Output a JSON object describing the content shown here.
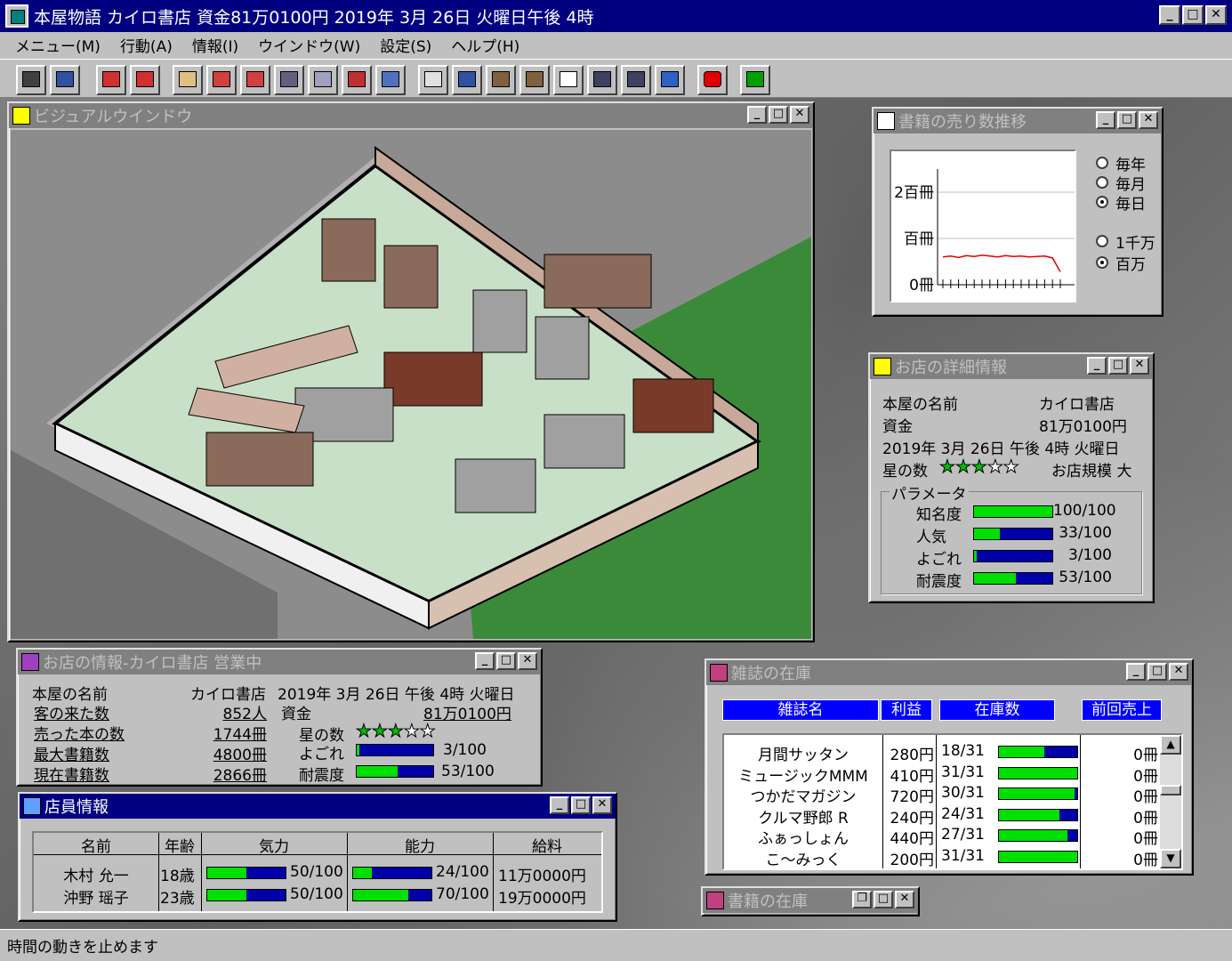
{
  "app": {
    "title": "本屋物語 カイロ書店 資金81万0100円 2019年 3月 26日 火曜日午後 4時"
  },
  "menu": [
    "メニュー(M)",
    "行動(A)",
    "情報(I)",
    "ウインドウ(W)",
    "設定(S)",
    "ヘルプ(H)"
  ],
  "visual_window": {
    "title": "ビジュアルウインドウ"
  },
  "sales_chart": {
    "title": "書籍の売り数推移",
    "radio_period": [
      "毎年",
      "毎月",
      "毎日"
    ],
    "selected_period": "毎日",
    "radio_unit": [
      "1千万",
      "百万"
    ],
    "selected_unit": "百万"
  },
  "chart_data": {
    "type": "line",
    "title": "",
    "xlabel": "",
    "ylabel": "",
    "y_tick_labels": [
      "0冊",
      "百冊",
      "2百冊"
    ],
    "ylim": [
      0,
      250
    ],
    "x": [
      1,
      2,
      3,
      4,
      5,
      6,
      7,
      8,
      9,
      10,
      11,
      12,
      13,
      14,
      15,
      16
    ],
    "values": [
      60,
      62,
      59,
      63,
      61,
      64,
      62,
      60,
      63,
      61,
      62,
      60,
      61,
      62,
      58,
      28
    ],
    "grid": true
  },
  "shop_detail": {
    "title": "お店の詳細情報",
    "name_label": "本屋の名前",
    "name_value": "カイロ書店",
    "funds_label": "資金",
    "funds_value": "81万0100円",
    "date": "2019年 3月 26日 午後 4時 火曜日",
    "stars_label": "星の数",
    "stars": 3,
    "stars_max": 5,
    "scale": "お店規模 大",
    "params_label": "パラメータ",
    "params": [
      {
        "label": "知名度",
        "value": "100/100",
        "ratio": 1.0
      },
      {
        "label": "人気",
        "value": "33/100",
        "ratio": 0.33
      },
      {
        "label": "よごれ",
        "value": "3/100",
        "ratio": 0.03
      },
      {
        "label": "耐震度",
        "value": "53/100",
        "ratio": 0.53
      }
    ]
  },
  "shop_info": {
    "title": "お店の情報-カイロ書店 営業中",
    "name_label": "本屋の名前",
    "name_value": "カイロ書店",
    "date": "2019年 3月 26日 午後 4時 火曜日",
    "rows": [
      {
        "label": "客の来た数",
        "value": "852人"
      },
      {
        "label": "売った本の数",
        "value": "1744冊"
      },
      {
        "label": "最大書籍数",
        "value": "4800冊"
      },
      {
        "label": "現在書籍数",
        "value": "2866冊"
      }
    ],
    "funds_label": "資金",
    "funds_value": "81万0100円",
    "stars_label": "星の数",
    "stars": 3,
    "dirt_label": "よごれ",
    "dirt_value": "3/100",
    "dirt_ratio": 0.03,
    "quake_label": "耐震度",
    "quake_value": "53/100",
    "quake_ratio": 0.53
  },
  "staff": {
    "title": "店員情報",
    "headers": [
      "名前",
      "年齢",
      "気力",
      "能力",
      "給料"
    ],
    "rows": [
      {
        "name": "木村 允一",
        "age": "18歳",
        "morale": "50/100",
        "morale_ratio": 0.5,
        "ability": "24/100",
        "ability_ratio": 0.24,
        "salary": "11万0000円"
      },
      {
        "name": "沖野 瑶子",
        "age": "23歳",
        "morale": "50/100",
        "morale_ratio": 0.5,
        "ability": "70/100",
        "ability_ratio": 0.7,
        "salary": "19万0000円"
      }
    ]
  },
  "magazines": {
    "title": "雑誌の在庫",
    "headers": [
      "雑誌名",
      "利益",
      "在庫数",
      "前回売上"
    ],
    "rows": [
      {
        "name": "月間サッタン",
        "profit": "280円",
        "stock": "18/31",
        "stock_ratio": 0.58,
        "sales": "0冊"
      },
      {
        "name": "ミュージックMMM",
        "profit": "410円",
        "stock": "31/31",
        "stock_ratio": 1.0,
        "sales": "0冊"
      },
      {
        "name": "つかだマガジン",
        "profit": "720円",
        "stock": "30/31",
        "stock_ratio": 0.97,
        "sales": "0冊"
      },
      {
        "name": "クルマ野郎 R",
        "profit": "240円",
        "stock": "24/31",
        "stock_ratio": 0.77,
        "sales": "0冊"
      },
      {
        "name": "ふぁっしょん",
        "profit": "440円",
        "stock": "27/31",
        "stock_ratio": 0.87,
        "sales": "0冊"
      },
      {
        "name": "こ〜みっく",
        "profit": "200円",
        "stock": "31/31",
        "stock_ratio": 1.0,
        "sales": "0冊"
      }
    ]
  },
  "books_window": {
    "title": "書籍の在庫"
  },
  "status": {
    "text": "時間の動きを止めます"
  },
  "colors": {
    "titlebar": "#000080",
    "bar_fill": "#00e000",
    "bar_bg": "#0000a8",
    "header_blue": "#0000ff"
  }
}
